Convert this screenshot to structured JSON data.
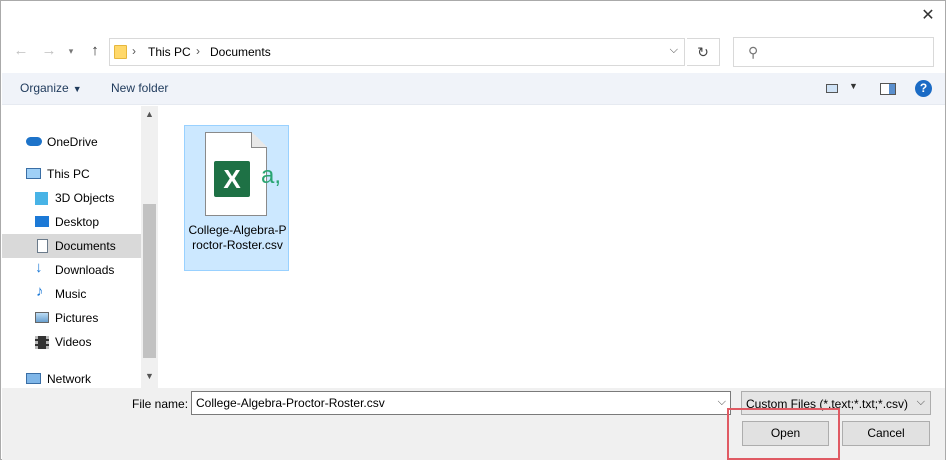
{
  "address_bar": {
    "crumbs": [
      "This PC",
      "Documents"
    ]
  },
  "search": {
    "placeholder": ""
  },
  "toolbar": {
    "organize_label": "Organize",
    "new_folder_label": "New folder"
  },
  "sidebar": {
    "items": [
      {
        "label": "OneDrive",
        "icon": "onedrive-icon",
        "selected": false
      },
      {
        "label": "This PC",
        "icon": "computer-icon",
        "selected": false
      },
      {
        "label": "3D Objects",
        "icon": "cube-icon",
        "selected": false
      },
      {
        "label": "Desktop",
        "icon": "desktop-icon",
        "selected": false
      },
      {
        "label": "Documents",
        "icon": "document-icon",
        "selected": true
      },
      {
        "label": "Downloads",
        "icon": "download-arrow-icon",
        "selected": false
      },
      {
        "label": "Music",
        "icon": "music-note-icon",
        "selected": false
      },
      {
        "label": "Pictures",
        "icon": "picture-icon",
        "selected": false
      },
      {
        "label": "Videos",
        "icon": "film-icon",
        "selected": false
      },
      {
        "label": "Network",
        "icon": "network-icon",
        "selected": false
      }
    ]
  },
  "files": [
    {
      "name": "College-Algebra-Proctor-Roster.csv",
      "icon": "excel-csv-file-icon",
      "selected": true
    }
  ],
  "footer": {
    "file_name_label": "File name:",
    "file_name_value": "College-Algebra-Proctor-Roster.csv",
    "file_type_value": "Custom Files (*.text;*.txt;*.csv)",
    "open_label": "Open",
    "cancel_label": "Cancel"
  },
  "colors": {
    "highlight_box": "#e05a63",
    "selection": "#cce8ff",
    "excel_green": "#1e7145"
  }
}
